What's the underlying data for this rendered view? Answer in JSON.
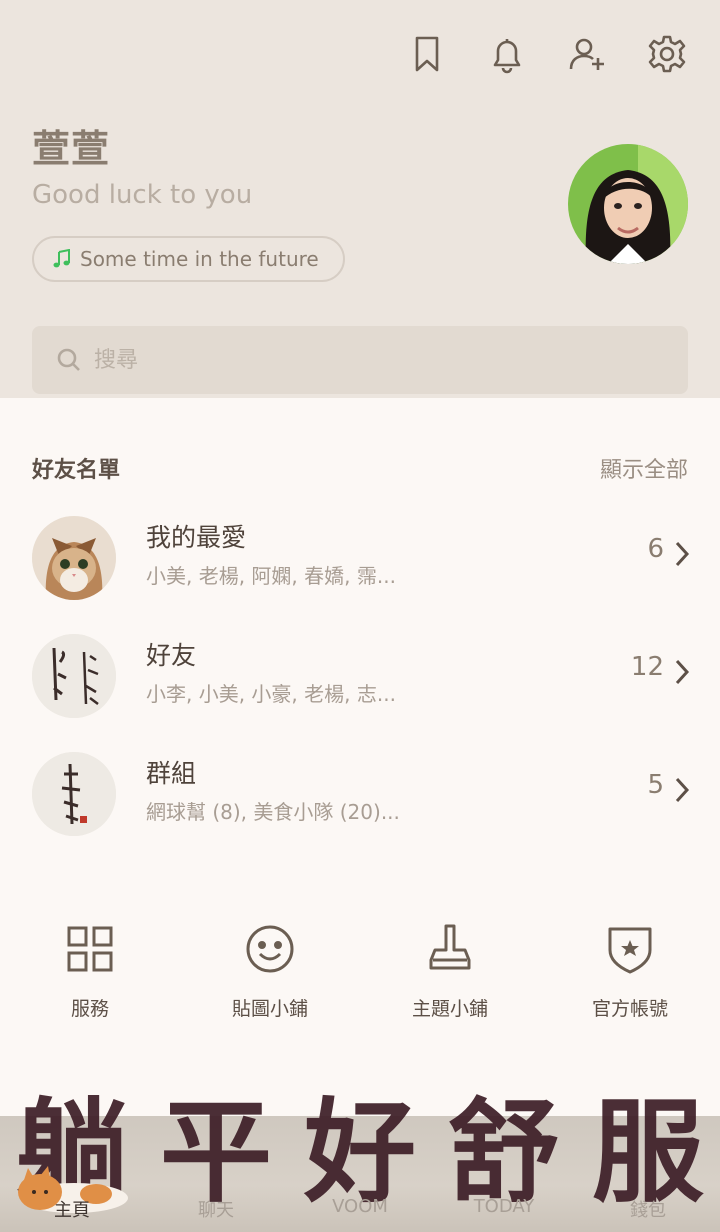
{
  "header": {
    "icons": [
      "bookmark-icon",
      "bell-icon",
      "add-friend-icon",
      "settings-icon"
    ],
    "profile": {
      "name": "萱萱",
      "status": "Good luck to you",
      "music": "Some time in the future"
    }
  },
  "search": {
    "placeholder": "搜尋"
  },
  "friends_section": {
    "title": "好友名單",
    "show_all": "顯示全部",
    "items": [
      {
        "title": "我的最愛",
        "subtitle": "小美, 老楊, 阿嫻, 春嬌, 霈...",
        "count": "6"
      },
      {
        "title": "好友",
        "subtitle": "小李, 小美, 小豪, 老楊, 志...",
        "count": "12"
      },
      {
        "title": "群組",
        "subtitle": "網球幫 (8), 美食小隊 (20)...",
        "count": "5"
      }
    ]
  },
  "shortcuts": [
    {
      "label": "服務",
      "icon": "grid-icon"
    },
    {
      "label": "貼圖小鋪",
      "icon": "smiley-icon"
    },
    {
      "label": "主題小鋪",
      "icon": "brush-icon"
    },
    {
      "label": "官方帳號",
      "icon": "shield-star-icon"
    }
  ],
  "banner": {
    "text": [
      "躺",
      "平",
      "好",
      "舒",
      "服"
    ]
  },
  "nav": [
    "主頁",
    "聊天",
    "VOOM",
    "TODAY",
    "錢包"
  ],
  "colors": {
    "header_bg": "#ece5de",
    "body_bg": "#fcf8f5",
    "text_dark": "#4f433b",
    "music_icon": "#3fbf5c"
  }
}
